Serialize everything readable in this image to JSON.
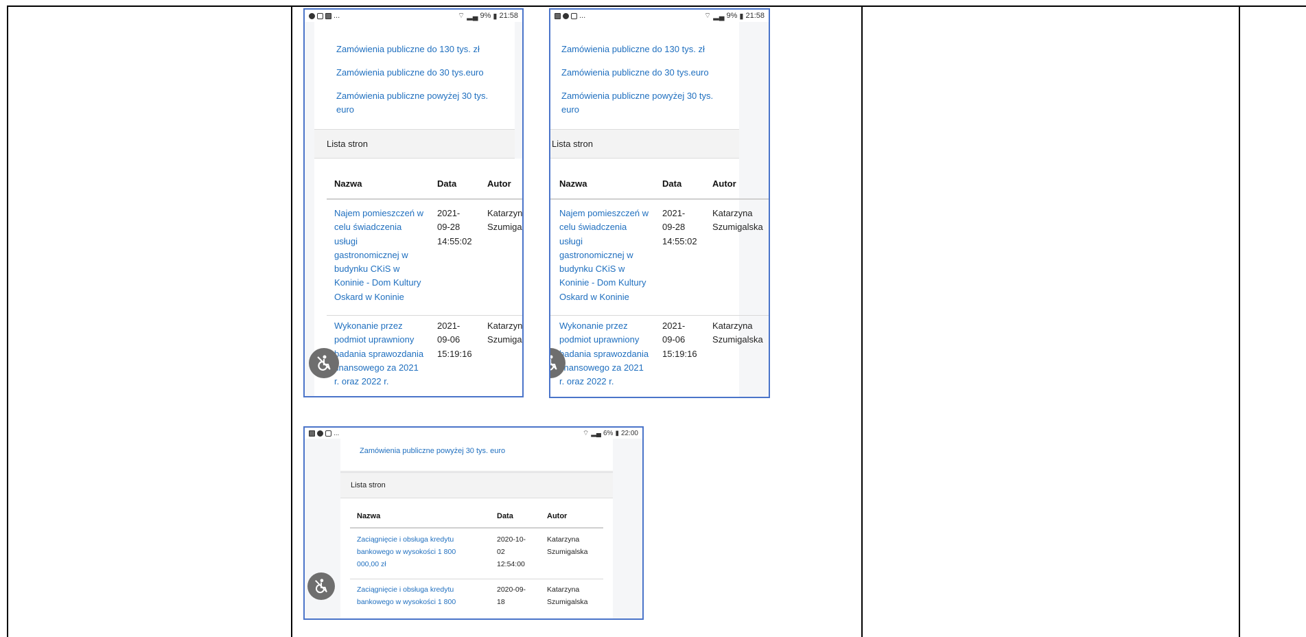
{
  "screens": [
    {
      "status": {
        "left_icons": [
          "messenger-icon",
          "instagram-icon",
          "gallery-icon"
        ],
        "more": "...",
        "right_text": "9%",
        "time": "21:58"
      },
      "links": [
        "Zamówienia publiczne do 130 tys. zł",
        "Zamówienia publiczne do 30 tys.euro",
        "Zamówienia publiczne powyżej 30 tys. euro"
      ],
      "section_header": "Lista stron",
      "columns": [
        "Nazwa",
        "Data",
        "Autor"
      ],
      "rows": [
        {
          "name_lines": [
            "Najem pomieszczeń w",
            "celu świadczenia",
            "usługi",
            "gastronomicznej w",
            "budynku CKiS w",
            "Koninie - Dom Kultury",
            "Oskard w Koninie"
          ],
          "date_lines": [
            "2021-",
            "09-28",
            "14:55:02"
          ],
          "author_lines": [
            "Katarzyna",
            "Szumigalska"
          ]
        },
        {
          "name_lines": [
            "Wykonanie przez",
            "podmiot uprawniony",
            "badania sprawozdania",
            "finansowego za 2021",
            "r. oraz 2022 r."
          ],
          "date_lines": [
            "2021-",
            "09-06",
            "15:19:16"
          ],
          "author_lines": [
            "Katarzyna",
            "Szumigalska"
          ]
        }
      ]
    },
    {
      "status": {
        "left_icons": [
          "gallery-icon",
          "messenger-icon",
          "instagram-icon"
        ],
        "more": "...",
        "right_text": "9%",
        "time": "21:58"
      },
      "links": [
        "Zamówienia publiczne do 130 tys. zł",
        "Zamówienia publiczne do 30 tys.euro",
        "Zamówienia publiczne powyżej 30 tys. euro"
      ],
      "section_header": "Lista stron",
      "columns": [
        "Nazwa",
        "Data",
        "Autor"
      ],
      "rows": [
        {
          "name_lines": [
            "Najem pomieszczeń w",
            "celu świadczenia",
            "usługi",
            "gastronomicznej w",
            "budynku CKiS w",
            "Koninie - Dom Kultury",
            "Oskard w Koninie"
          ],
          "date_lines": [
            "2021-",
            "09-28",
            "14:55:02"
          ],
          "author_lines": [
            "Katarzyna",
            "Szumigalska"
          ]
        },
        {
          "name_lines": [
            "Wykonanie przez",
            "podmiot uprawniony",
            "badania sprawozdania",
            "finansowego za 2021",
            "r. oraz 2022 r."
          ],
          "date_lines": [
            "2021-",
            "09-06",
            "15:19:16"
          ],
          "author_lines": [
            "Katarzyna",
            "Szumigalska"
          ]
        }
      ]
    },
    {
      "status": {
        "left_icons": [
          "gallery-icon",
          "messenger-icon",
          "instagram-icon"
        ],
        "more": "...",
        "right_text": "6%",
        "time": "22:00"
      },
      "links": [
        "Zamówienia publiczne powyżej 30 tys. euro"
      ],
      "section_header": "Lista stron",
      "columns": [
        "Nazwa",
        "Data",
        "Autor"
      ],
      "rows": [
        {
          "name_lines": [
            "Zaciągnięcie i obsługa kredytu",
            "bankowego w wysokości 1 800",
            "000,00 zł"
          ],
          "date_lines": [
            "2020-10-",
            "02",
            "12:54:00"
          ],
          "author_lines": [
            "Katarzyna",
            "Szumigalska"
          ]
        },
        {
          "name_lines": [
            "Zaciągnięcie i obsługa kredytu",
            "bankowego w wysokości 1 800"
          ],
          "date_lines": [
            "2020-09-",
            "18"
          ],
          "author_lines": [
            "Katarzyna",
            "Szumigalska"
          ]
        }
      ]
    }
  ]
}
